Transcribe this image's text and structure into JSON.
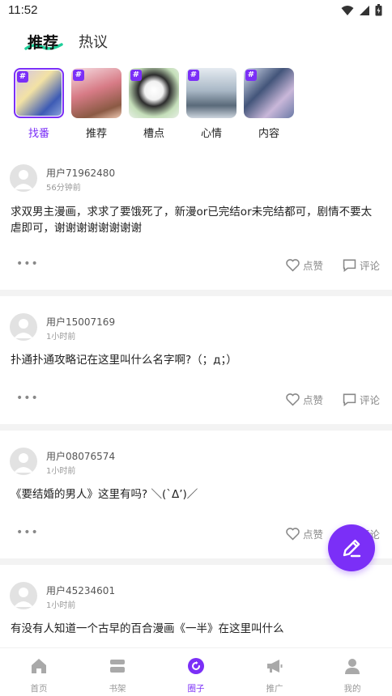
{
  "status_bar": {
    "time": "11:52"
  },
  "tabs": {
    "active": "推荐",
    "inactive": "热议"
  },
  "topics": [
    {
      "label": "找番",
      "active": true,
      "colors": [
        "#d9c8f2",
        "#3d5bb5",
        "#f4e2a8"
      ]
    },
    {
      "label": "推荐",
      "active": false,
      "colors": [
        "#f3d9df",
        "#c95f6b",
        "#7f4d3a"
      ]
    },
    {
      "label": "槽点",
      "active": false,
      "colors": [
        "#e8f0e6",
        "#2d2d2d",
        "#c5dfba"
      ]
    },
    {
      "label": "心情",
      "active": false,
      "colors": [
        "#dfe6ee",
        "#8c9fb3",
        "#5a6a7a"
      ]
    },
    {
      "label": "内容",
      "active": false,
      "colors": [
        "#d8dff0",
        "#43557a",
        "#c9b7d9"
      ]
    }
  ],
  "posts": [
    {
      "username": "用户71962480",
      "time": "56分钟前",
      "content": "求双男主漫画，求求了要饿死了，新漫or已完结or未完结都可，剧情不要太虐即可，谢谢谢谢谢谢谢谢"
    },
    {
      "username": "用户15007169",
      "time": "1小时前",
      "content": "扑通扑通攻略记在这里叫什么名字啊?（；д；）"
    },
    {
      "username": "用户08076574",
      "time": "1小时前",
      "content": "《要结婚的男人》这里有吗? ＼(`Δ’)／"
    },
    {
      "username": "用户45234601",
      "time": "1小时前",
      "content": "有没有人知道一个古早的百合漫画《一半》在这里叫什么"
    }
  ],
  "actions": {
    "more": "•••",
    "like": "点赞",
    "comment": "评论"
  },
  "bottom_nav": [
    {
      "label": "首页",
      "icon": "home-icon",
      "active": false
    },
    {
      "label": "书架",
      "icon": "bookshelf-icon",
      "active": false
    },
    {
      "label": "圈子",
      "icon": "circle-icon",
      "active": true
    },
    {
      "label": "推广",
      "icon": "megaphone-icon",
      "active": false
    },
    {
      "label": "我的",
      "icon": "profile-icon",
      "active": false
    }
  ],
  "colors": {
    "accent": "#7b2ff7",
    "underline": "#1fcf9a"
  }
}
